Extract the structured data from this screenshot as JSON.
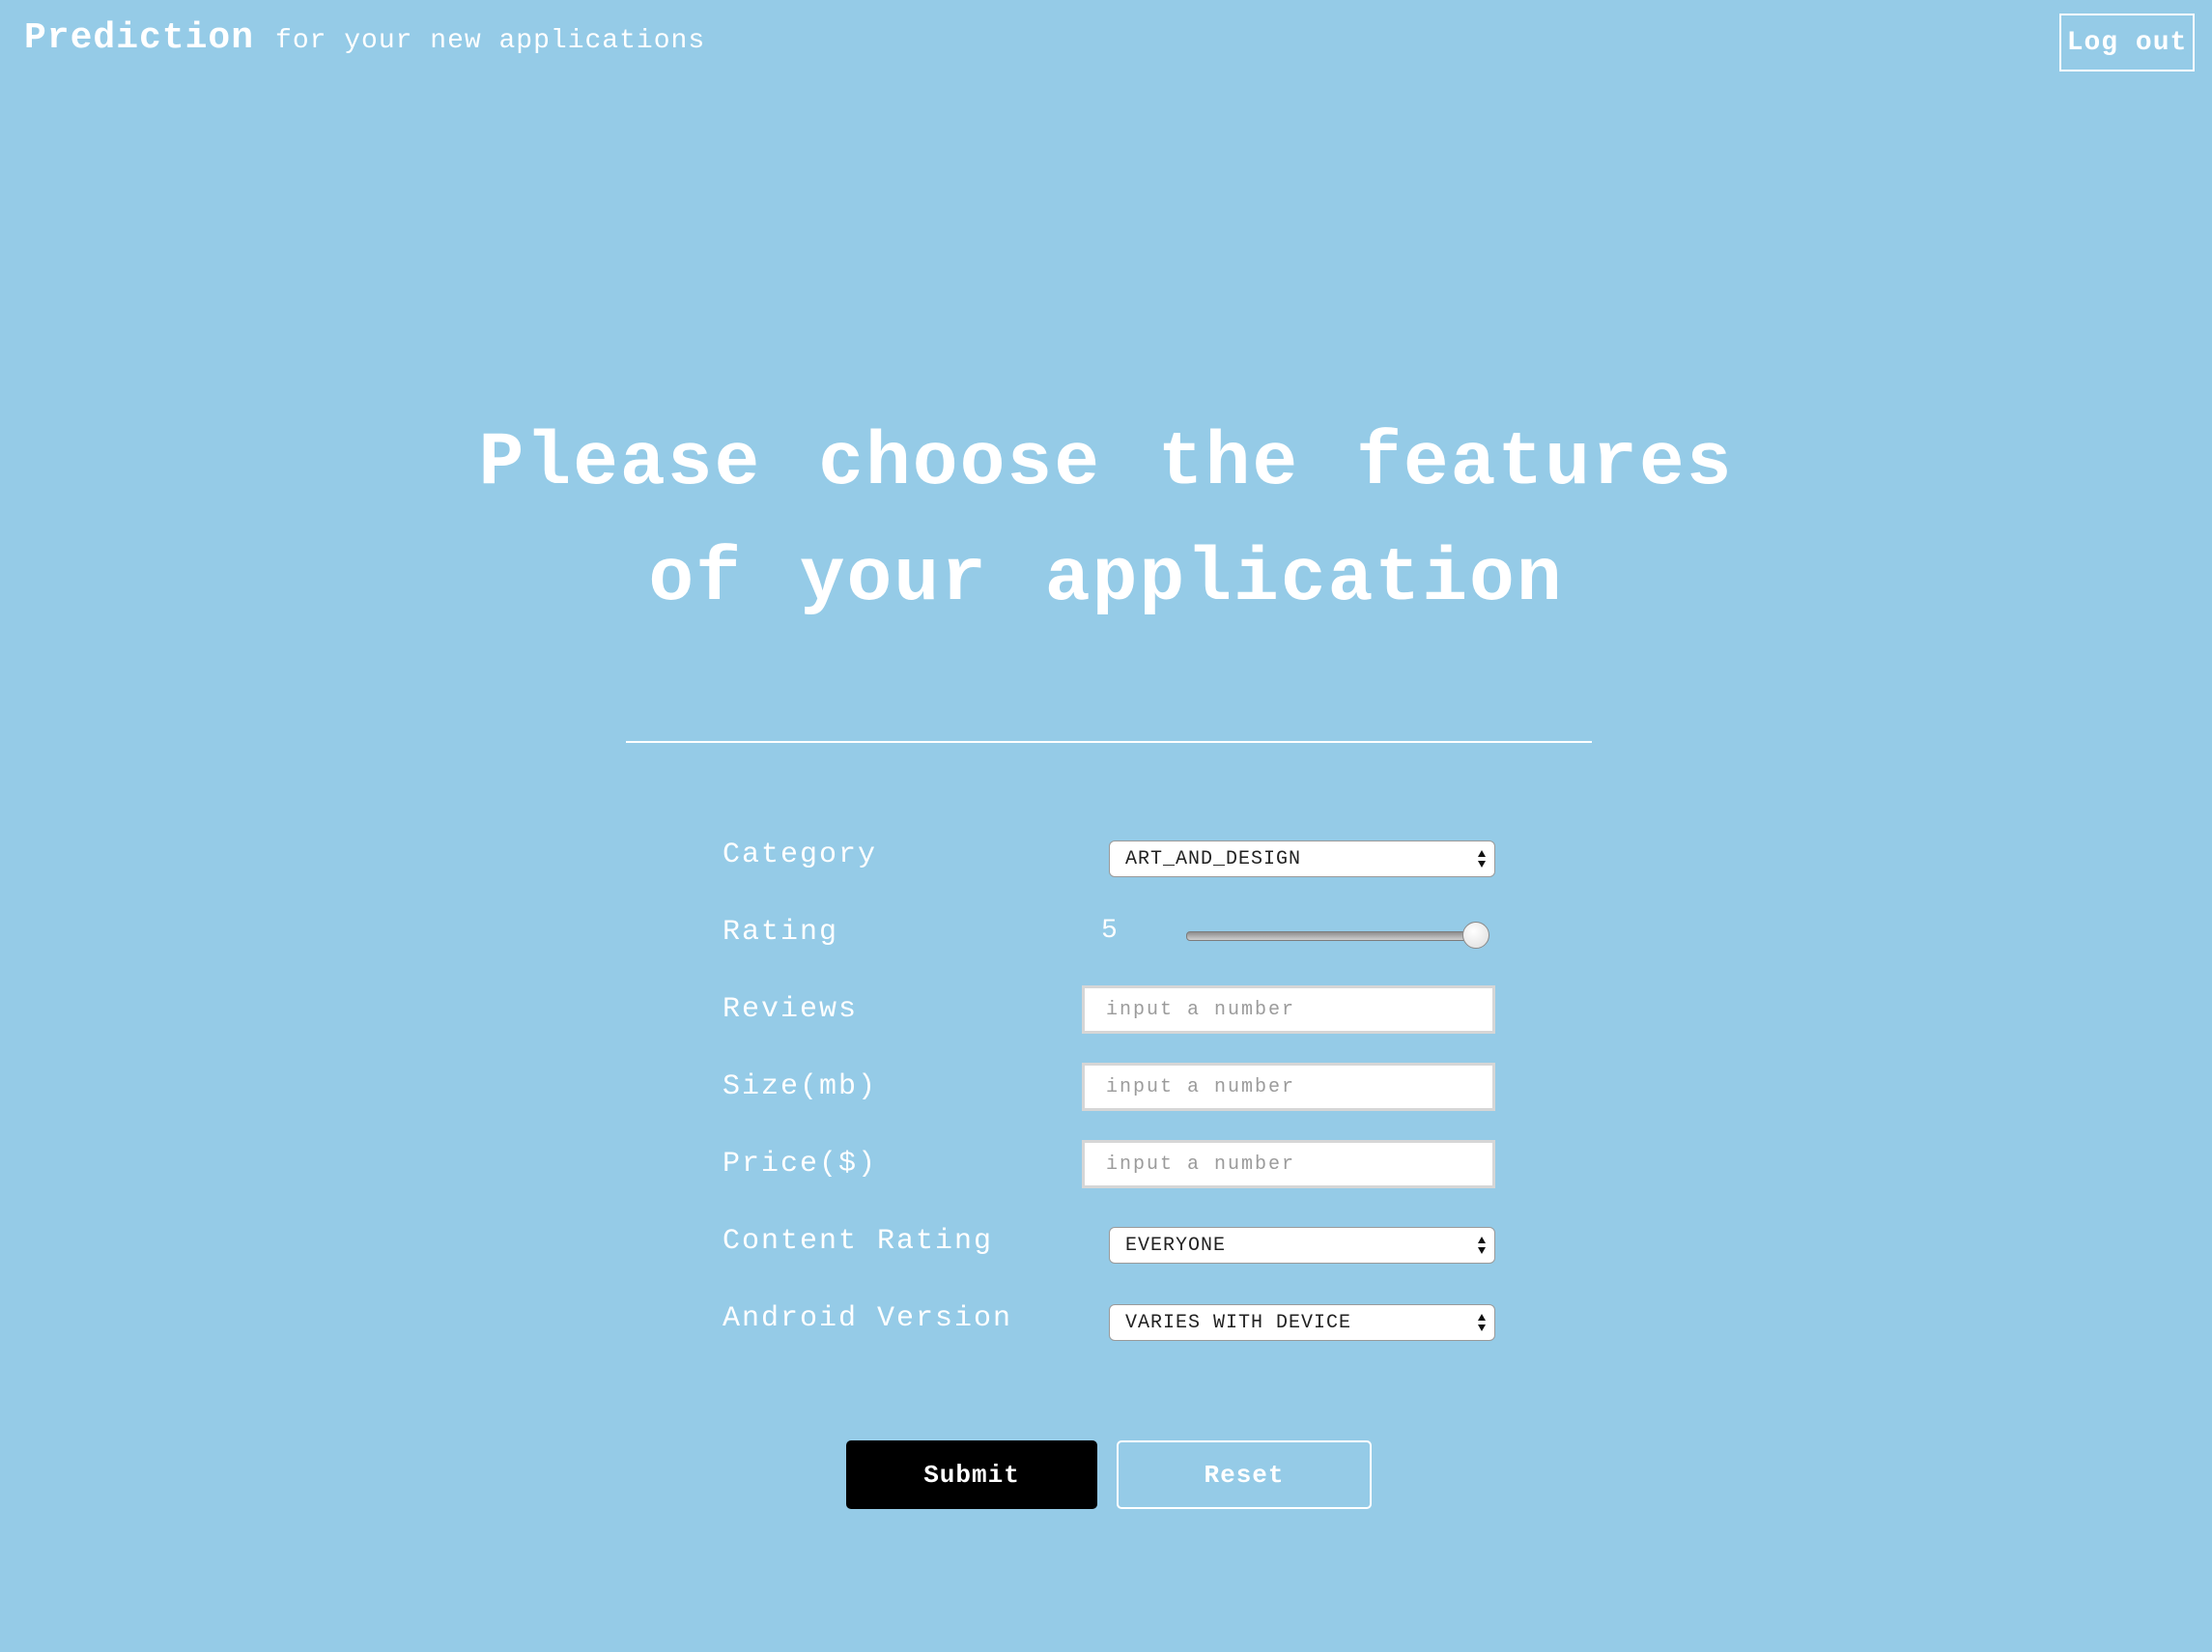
{
  "header": {
    "brand": "Prediction",
    "tagline": "for your new applications",
    "logout_label": "Log out"
  },
  "hero": {
    "line1": "Please choose the features",
    "line2": "of your application"
  },
  "form": {
    "category": {
      "label": "Category",
      "value": "ART_AND_DESIGN"
    },
    "rating": {
      "label": "Rating",
      "value": "5",
      "min": 0,
      "max": 5,
      "fraction": 1.0
    },
    "reviews": {
      "label": "Reviews",
      "placeholder": "input a number"
    },
    "size": {
      "label": "Size(mb)",
      "placeholder": "input a number"
    },
    "price": {
      "label": "Price($)",
      "placeholder": "input a number"
    },
    "content_rating": {
      "label": "Content Rating",
      "value": "EVERYONE"
    },
    "android_version": {
      "label": "Android Version",
      "value": "VARIES WITH DEVICE"
    }
  },
  "buttons": {
    "submit": "Submit",
    "reset": "Reset"
  },
  "colors": {
    "background": "#95cbe7",
    "text": "#ffffff",
    "submit_bg": "#000000"
  }
}
